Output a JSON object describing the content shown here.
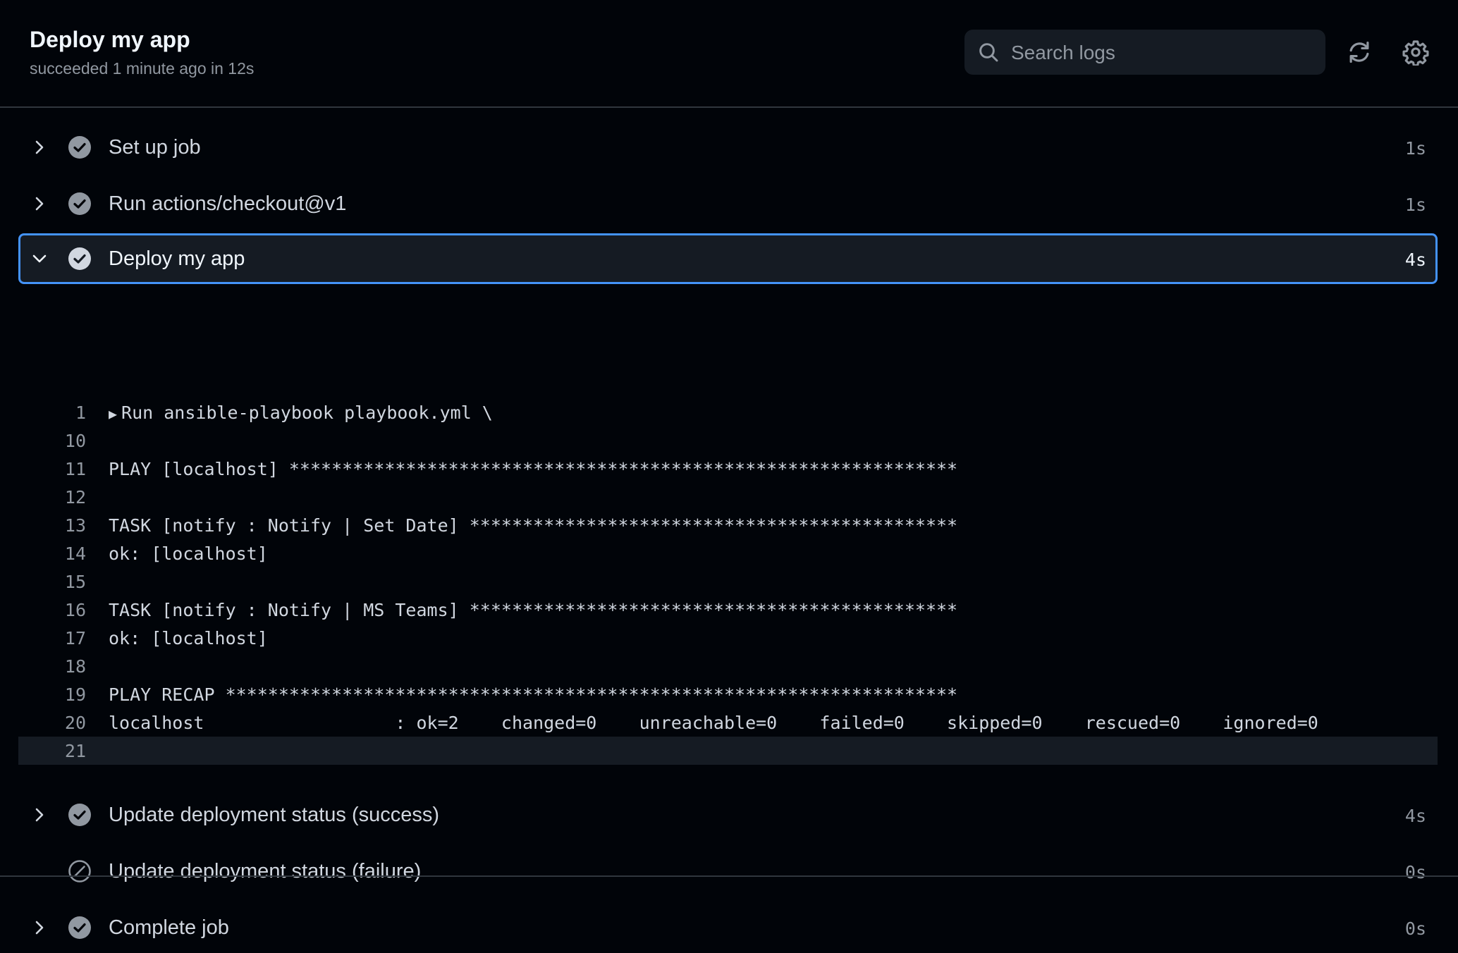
{
  "header": {
    "title": "Deploy my app",
    "subtitle": "succeeded 1 minute ago in 12s",
    "search_placeholder": "Search logs"
  },
  "colors": {
    "background": "#010409",
    "panel": "#151b23",
    "border": "#30363d",
    "accent": "#4493f8",
    "muted_text": "#9198a1"
  },
  "steps": [
    {
      "label": "Set up job",
      "duration": "1s",
      "status": "success",
      "expanded": false
    },
    {
      "label": "Run actions/checkout@v1",
      "duration": "1s",
      "status": "success",
      "expanded": false
    },
    {
      "label": "Deploy my app",
      "duration": "4s",
      "status": "success",
      "expanded": true
    },
    {
      "label": "Update deployment status (success)",
      "duration": "4s",
      "status": "success",
      "expanded": false
    },
    {
      "label": "Update deployment status (failure)",
      "duration": "0s",
      "status": "skipped",
      "expanded": false
    },
    {
      "label": "Complete job",
      "duration": "0s",
      "status": "success",
      "expanded": false
    }
  ],
  "log": [
    {
      "num": "1",
      "text": "Run ansible-playbook playbook.yml \\",
      "collapsible": true
    },
    {
      "num": "10",
      "text": ""
    },
    {
      "num": "11",
      "text": "PLAY [localhost] ***************************************************************"
    },
    {
      "num": "12",
      "text": ""
    },
    {
      "num": "13",
      "text": "TASK [notify : Notify | Set Date] **********************************************"
    },
    {
      "num": "14",
      "text": "ok: [localhost]"
    },
    {
      "num": "15",
      "text": ""
    },
    {
      "num": "16",
      "text": "TASK [notify : Notify | MS Teams] **********************************************"
    },
    {
      "num": "17",
      "text": "ok: [localhost]"
    },
    {
      "num": "18",
      "text": ""
    },
    {
      "num": "19",
      "text": "PLAY RECAP *********************************************************************"
    },
    {
      "num": "20",
      "text": "localhost                  : ok=2    changed=0    unreachable=0    failed=0    skipped=0    rescued=0    ignored=0"
    },
    {
      "num": "21",
      "text": "",
      "highlight": true
    }
  ]
}
